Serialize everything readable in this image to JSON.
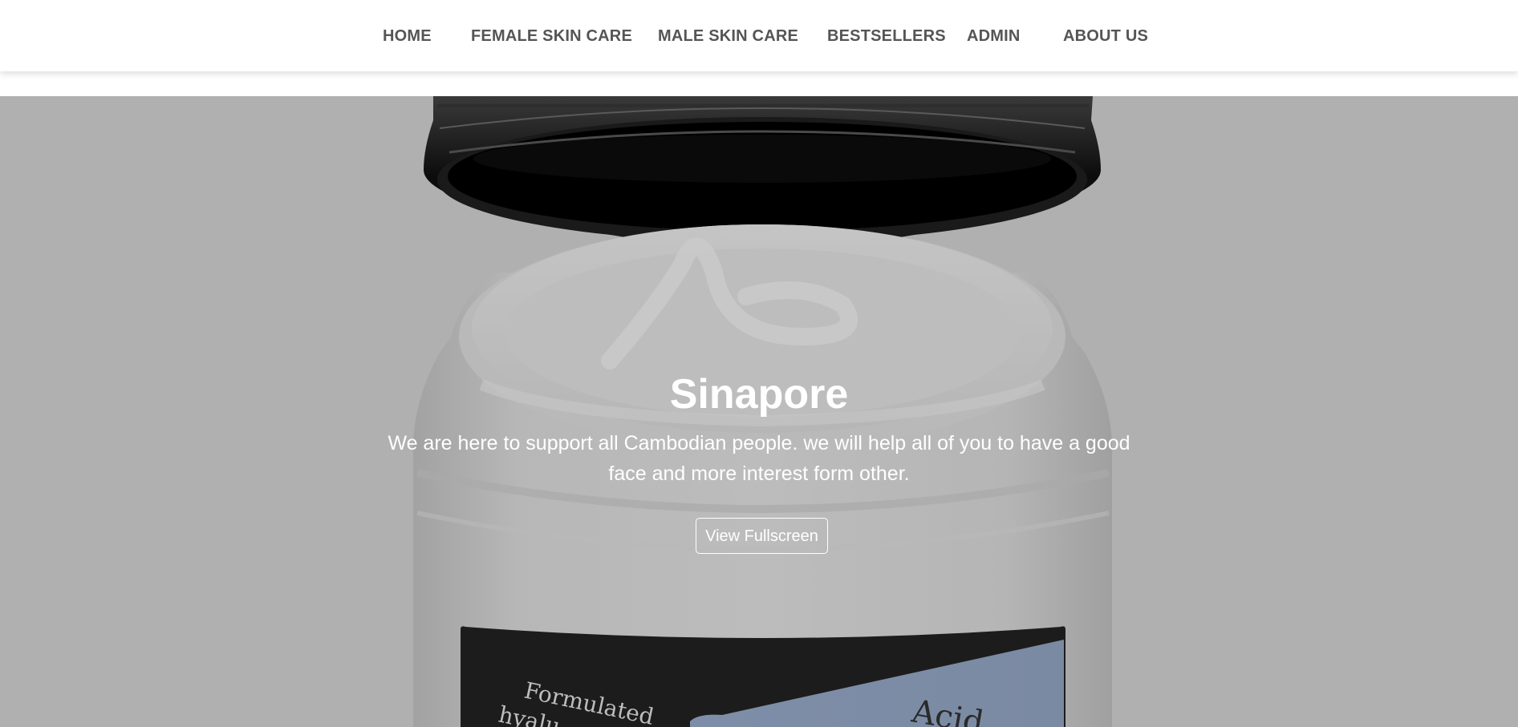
{
  "nav": {
    "items": [
      {
        "label": "HOME"
      },
      {
        "label": "FEMALE SKIN CARE"
      },
      {
        "label": "MALE SKIN CARE"
      },
      {
        "label": "BESTSELLERS"
      },
      {
        "label": "ADMIN"
      },
      {
        "label": "ABOUT US"
      }
    ]
  },
  "hero": {
    "title": "Sinapore",
    "description": "We are here to support all Cambodian people. we will help all of you to have a good face and more interest form other.",
    "button_label": "View Fullscreen",
    "product_label_text_1": "Formulated",
    "product_label_text_2": "hyalu",
    "product_label_text_3": "Acid"
  },
  "colors": {
    "nav_text": "#555555",
    "hero_overlay": "#b0b0b0",
    "hero_text": "#ffffff"
  }
}
